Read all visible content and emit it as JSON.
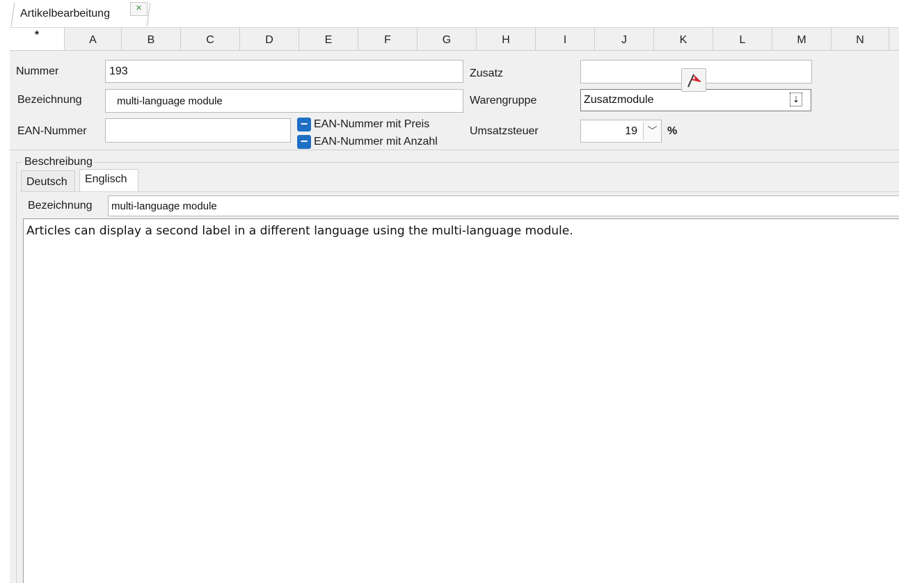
{
  "document_tab": {
    "label": "Artikelbearbeitung",
    "close_icon": "close-icon"
  },
  "columns": [
    "*",
    "A",
    "B",
    "C",
    "D",
    "E",
    "F",
    "G",
    "H",
    "I",
    "J",
    "K",
    "L",
    "M",
    "N"
  ],
  "form": {
    "nummer": {
      "label": "Nummer",
      "value": "193"
    },
    "bezeichnung": {
      "label": "Bezeichnung",
      "value": "multi-language module"
    },
    "ean": {
      "label": "EAN-Nummer",
      "value": ""
    },
    "ean_with_price": {
      "label": "EAN-Nummer mit Preis",
      "state": "indeterminate"
    },
    "ean_with_quantity": {
      "label": "EAN-Nummer mit Anzahl",
      "state": "indeterminate"
    },
    "zusatz": {
      "label": "Zusatz",
      "value": ""
    },
    "warengruppe": {
      "label": "Warengruppe",
      "value": "Zusatzmodule"
    },
    "umsatzsteuer": {
      "label": "Umsatzsteuer",
      "value": "19",
      "unit": "%"
    }
  },
  "beschreibung": {
    "legend": "Beschreibung",
    "tabs": [
      {
        "label": "Deutsch",
        "active": false
      },
      {
        "label": "Englisch",
        "active": true
      }
    ],
    "bezeichnung": {
      "label": "Bezeichnung",
      "value": "multi-language module"
    },
    "text": "Articles can display a second label in a different language using the multi-language module."
  },
  "colors": {
    "checkbox_blue": "#1f6fc4",
    "panel_gray": "#f0f0f0",
    "flag_red": "#d4202a"
  }
}
